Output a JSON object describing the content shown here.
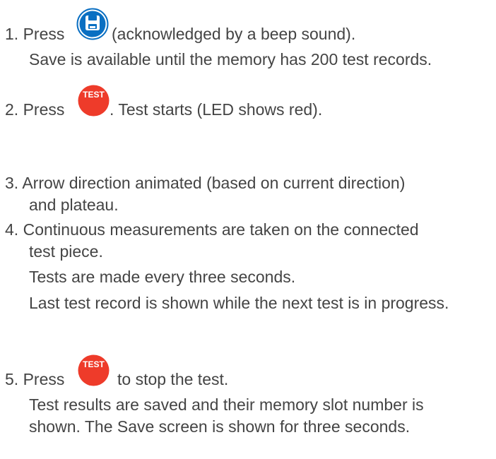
{
  "steps": [
    {
      "number": "1.",
      "lead": "Press",
      "icon": "save-icon",
      "trail": "(acknowledged by a beep sound).",
      "notes": [
        "Save is available until the memory has 200 test records."
      ]
    },
    {
      "number": "2.",
      "lead": "Press",
      "icon": "test-button-icon",
      "icon_label": "TEST",
      "trail": ". Test starts (LED shows red)."
    },
    {
      "number": "3.",
      "lines": [
        "Arrow direction animated (based on current direction)",
        "and plateau."
      ]
    },
    {
      "number": "4.",
      "lines": [
        "Continuous measurements are taken on the connected",
        "test piece."
      ],
      "notes": [
        "Tests are made every three seconds.",
        "Last test record is shown while the next test is in progress."
      ]
    },
    {
      "number": "5.",
      "lead": "Press",
      "icon": "test-button-icon",
      "icon_label": "TEST",
      "trail": "to stop the test.",
      "notes_lines": [
        "Test results are saved and their memory slot number is",
        "shown. The Save screen is shown for three seconds."
      ]
    }
  ],
  "colors": {
    "text": "#444444",
    "save_icon_blue": "#0a6fc2",
    "test_icon_red": "#ee3b2a"
  }
}
